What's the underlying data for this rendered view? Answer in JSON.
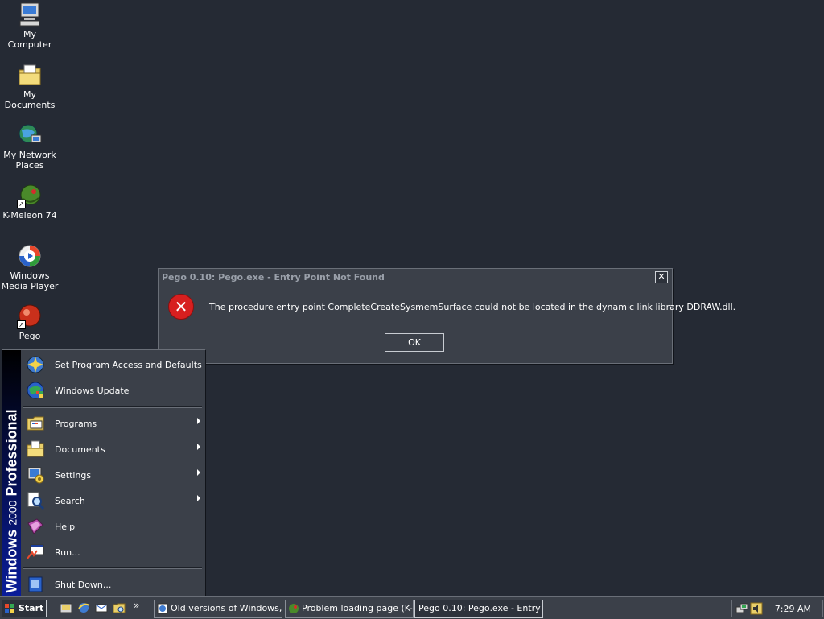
{
  "desktop": {
    "icons": [
      {
        "label": "My Computer",
        "icon": "computer-icon"
      },
      {
        "label": "My Documents",
        "icon": "documents-folder-icon"
      },
      {
        "label": "My Network Places",
        "icon": "network-places-icon"
      },
      {
        "label": "K-Meleon 74",
        "icon": "k-meleon-icon"
      },
      {
        "label": "Windows Media Player",
        "icon": "media-player-icon"
      },
      {
        "label": "Pego",
        "icon": "pego-icon"
      }
    ]
  },
  "dialog": {
    "title": "Pego 0.10: Pego.exe - Entry Point Not Found",
    "message": "The procedure entry point CompleteCreateSysmemSurface could not be located in the dynamic link library DDRAW.dll.",
    "ok_label": "OK",
    "close_glyph": "✕",
    "error_glyph": "✕"
  },
  "start_menu": {
    "banner": {
      "brand": "Windows",
      "version": "2000",
      "edition": "Professional"
    },
    "items": [
      {
        "label": "Set Program Access and Defaults",
        "icon": "program-access-icon",
        "submenu": false
      },
      {
        "label": "Windows Update",
        "icon": "windows-update-icon",
        "submenu": false
      },
      {
        "label": "Programs",
        "icon": "programs-icon",
        "submenu": true
      },
      {
        "label": "Documents",
        "icon": "documents-icon",
        "submenu": true
      },
      {
        "label": "Settings",
        "icon": "settings-icon",
        "submenu": true
      },
      {
        "label": "Search",
        "icon": "search-icon",
        "submenu": true
      },
      {
        "label": "Help",
        "icon": "help-icon",
        "submenu": false
      },
      {
        "label": "Run...",
        "icon": "run-icon",
        "submenu": false
      },
      {
        "label": "Shut Down...",
        "icon": "shutdown-icon",
        "submenu": false
      }
    ]
  },
  "taskbar": {
    "start_label": "Start",
    "quick_launch_more": "»",
    "tasks": [
      {
        "label": "Old versions of Windows,...",
        "icon": "ie-page-icon",
        "active": false
      },
      {
        "label": "Problem loading page (K-...",
        "icon": "k-meleon-icon",
        "active": false
      },
      {
        "label": "Pego 0.10: Pego.exe - Entry ...",
        "icon": "",
        "active": true
      }
    ],
    "clock": "7:29 AM"
  },
  "colors": {
    "desktop": "#252a34",
    "window": "#3b4049",
    "banner_top": "#000000",
    "banner_bottom": "#0a1d9b",
    "error_red": "#d71f1f"
  }
}
